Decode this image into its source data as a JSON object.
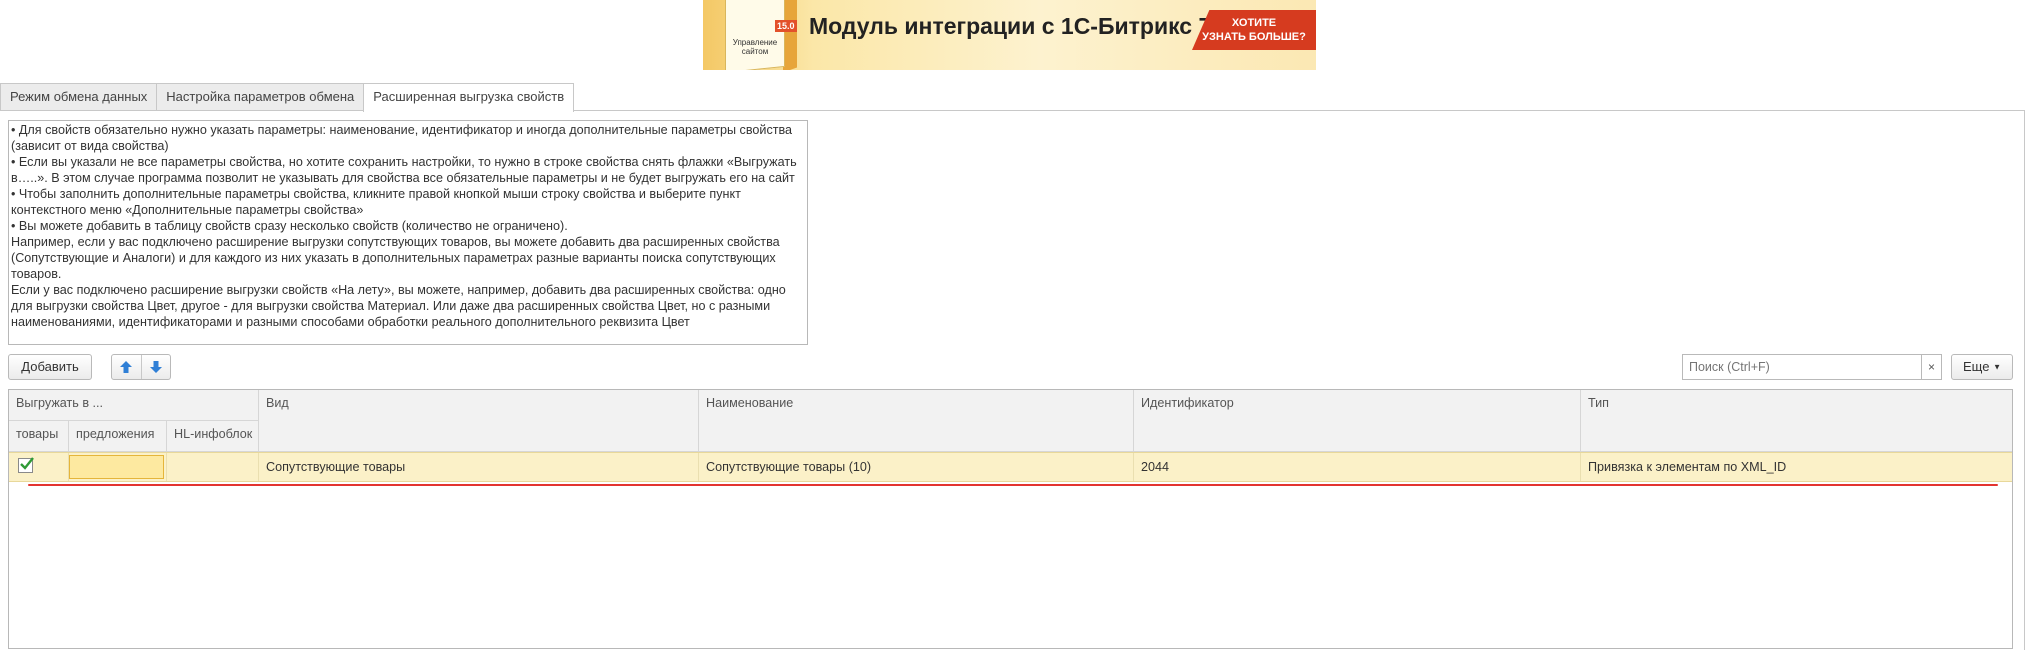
{
  "banner": {
    "title": "Модуль интеграции с 1С-Битрикс 7.x",
    "cta_line1": "ХОТИТЕ",
    "cta_line2": "УЗНАТЬ БОЛЬШЕ?",
    "box_label": "Управление сайтом",
    "box_version": "15.0"
  },
  "tabs": [
    {
      "label": "Режим обмена данных"
    },
    {
      "label": "Настройка параметров обмена"
    },
    {
      "label": "Расширенная выгрузка свойств"
    }
  ],
  "info_lines": [
    "• Для свойств обязательно нужно указать параметры: наименование, идентификатор и иногда дополнительные параметры свойства (зависит от вида свойства)",
    "• Если вы указали не все параметры свойства, но хотите сохранить настройки, то нужно в строке свойства снять флажки «Выгружать в…..». В этом случае программа позволит не указывать для свойства все обязательные параметры и не будет выгружать его на сайт",
    "• Чтобы заполнить дополнительные параметры свойства, кликните правой кнопкой мыши строку свойства и выберите пункт контекстного меню «Дополнительные параметры свойства»",
    "• Вы можете добавить в таблицу свойств сразу несколько свойств (количество не ограничено).",
    "Например, если у вас подключено расширение выгрузки сопутствующих товаров, вы можете добавить два расширенных свойства (Сопутствующие и Аналоги) и для каждого из них указать в дополнительных параметрах разные варианты поиска сопутствующих товаров.",
    "Если у вас подключено расширение выгрузки свойств «На лету», вы можете, например, добавить два расширенных свойства: одно для выгрузки свойства Цвет, другое - для выгрузки свойства Материал. Или даже два расширенных свойства Цвет, но с разными наименованиями, идентификаторами и разными способами обработки реального дополнительного реквизита Цвет"
  ],
  "toolbar": {
    "add_label": "Добавить",
    "search_placeholder": "Поиск (Ctrl+F)",
    "clear_label": "×",
    "more_label": "Еще"
  },
  "table": {
    "group_header": "Выгружать в ...",
    "sub_headers": [
      "товары",
      "предложения",
      "HL-инфоблок"
    ],
    "headers": [
      "Вид",
      "Наименование",
      "Идентификатор",
      "Тип"
    ],
    "rows": [
      {
        "tovary_checked": true,
        "vid": "Сопутствующие товары",
        "name": "Сопутствующие товары (10)",
        "id": "2044",
        "type": "Привязка к элементам по XML_ID"
      }
    ]
  },
  "colors": {
    "accent_red": "#e3342f",
    "arrow_blue": "#2f7fd6",
    "check_green": "#2f9a36",
    "row_highlight": "#fbf1c8"
  }
}
